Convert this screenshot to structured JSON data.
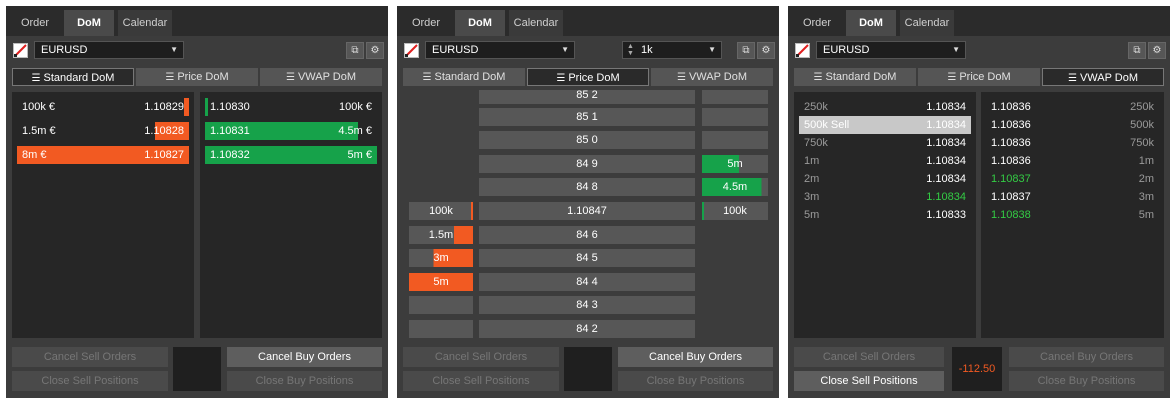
{
  "tabs": [
    "Order",
    "DoM",
    "Calendar"
  ],
  "symbol": "EURUSD",
  "quantity": "1k",
  "modes": [
    "Standard DoM",
    "Price DoM",
    "VWAP DoM"
  ],
  "icons": {
    "logo": "app-logo-icon",
    "chart": "chart-settings-icon",
    "gear": "gear-icon",
    "dropdown": "chevron-down-icon",
    "spinner": "spinner-icon",
    "list": "list-icon"
  },
  "colors": {
    "sell": "#f25a22",
    "buy": "#16a24a",
    "positive": "#33cc44",
    "negative": "#f25a22"
  },
  "panel1": {
    "sell": [
      {
        "vol": "100k €",
        "price": "1.10829",
        "fill": 0.03
      },
      {
        "vol": "1.5m €",
        "price": "1.10828",
        "fill": 0.2
      },
      {
        "vol": "8m €",
        "price": "1.10827",
        "fill": 1.0
      }
    ],
    "buy": [
      {
        "price": "1.10830",
        "vol": "100k €",
        "fill": 0.02
      },
      {
        "price": "1.10831",
        "vol": "4.5m €",
        "fill": 0.89
      },
      {
        "price": "1.10832",
        "vol": "5m €",
        "fill": 1.0
      }
    ],
    "buttons": {
      "cancel_sell": "Cancel Sell Orders",
      "close_sell": "Close Sell Positions",
      "cancel_buy": "Cancel Buy Orders",
      "close_buy": "Close Buy Positions"
    }
  },
  "panel2": {
    "ladder": [
      {
        "price": "85 2",
        "sell": "",
        "buy": ""
      },
      {
        "price": "85 1",
        "sell": "",
        "buy": ""
      },
      {
        "price": "85 0",
        "sell": "",
        "buy": ""
      },
      {
        "price": "84 9",
        "sell": "",
        "buy": "5m"
      },
      {
        "price": "84 8",
        "sell": "",
        "buy": "4.5m"
      },
      {
        "price": "1.10847",
        "sell": "100k",
        "buy": "100k"
      },
      {
        "price": "84 6",
        "sell": "1.5m",
        "buy": ""
      },
      {
        "price": "84 5",
        "sell": "3m",
        "buy": ""
      },
      {
        "price": "84 4",
        "sell": "5m",
        "buy": ""
      },
      {
        "price": "84 3",
        "sell": "",
        "buy": ""
      },
      {
        "price": "84 2",
        "sell": "",
        "buy": ""
      }
    ],
    "buttons": {
      "cancel_sell": "Cancel Sell Orders",
      "close_sell": "Close Sell Positions",
      "cancel_buy": "Cancel Buy Orders",
      "close_buy": "Close Buy Positions"
    }
  },
  "panel3": {
    "sell": [
      {
        "vol": "250k",
        "price": "1.10834"
      },
      {
        "vol": "500k Sell",
        "price": "1.10834"
      },
      {
        "vol": "750k",
        "price": "1.10834"
      },
      {
        "vol": "1m",
        "price": "1.10834"
      },
      {
        "vol": "2m",
        "price": "1.10834"
      },
      {
        "vol": "3m",
        "price": "1.10834"
      },
      {
        "vol": "5m",
        "price": "1.10833"
      }
    ],
    "buy": [
      {
        "price": "1.10836",
        "vol": "250k"
      },
      {
        "price": "1.10836",
        "vol": "500k"
      },
      {
        "price": "1.10836",
        "vol": "750k"
      },
      {
        "price": "1.10836",
        "vol": "1m"
      },
      {
        "price": "1.10837",
        "vol": "2m"
      },
      {
        "price": "1.10837",
        "vol": "3m"
      },
      {
        "price": "1.10838",
        "vol": "5m"
      }
    ],
    "pnl": "-112.50",
    "buttons": {
      "cancel_sell": "Cancel Sell Orders",
      "close_sell": "Close Sell Positions",
      "cancel_buy": "Cancel Buy Orders",
      "close_buy": "Close Buy Positions"
    }
  }
}
